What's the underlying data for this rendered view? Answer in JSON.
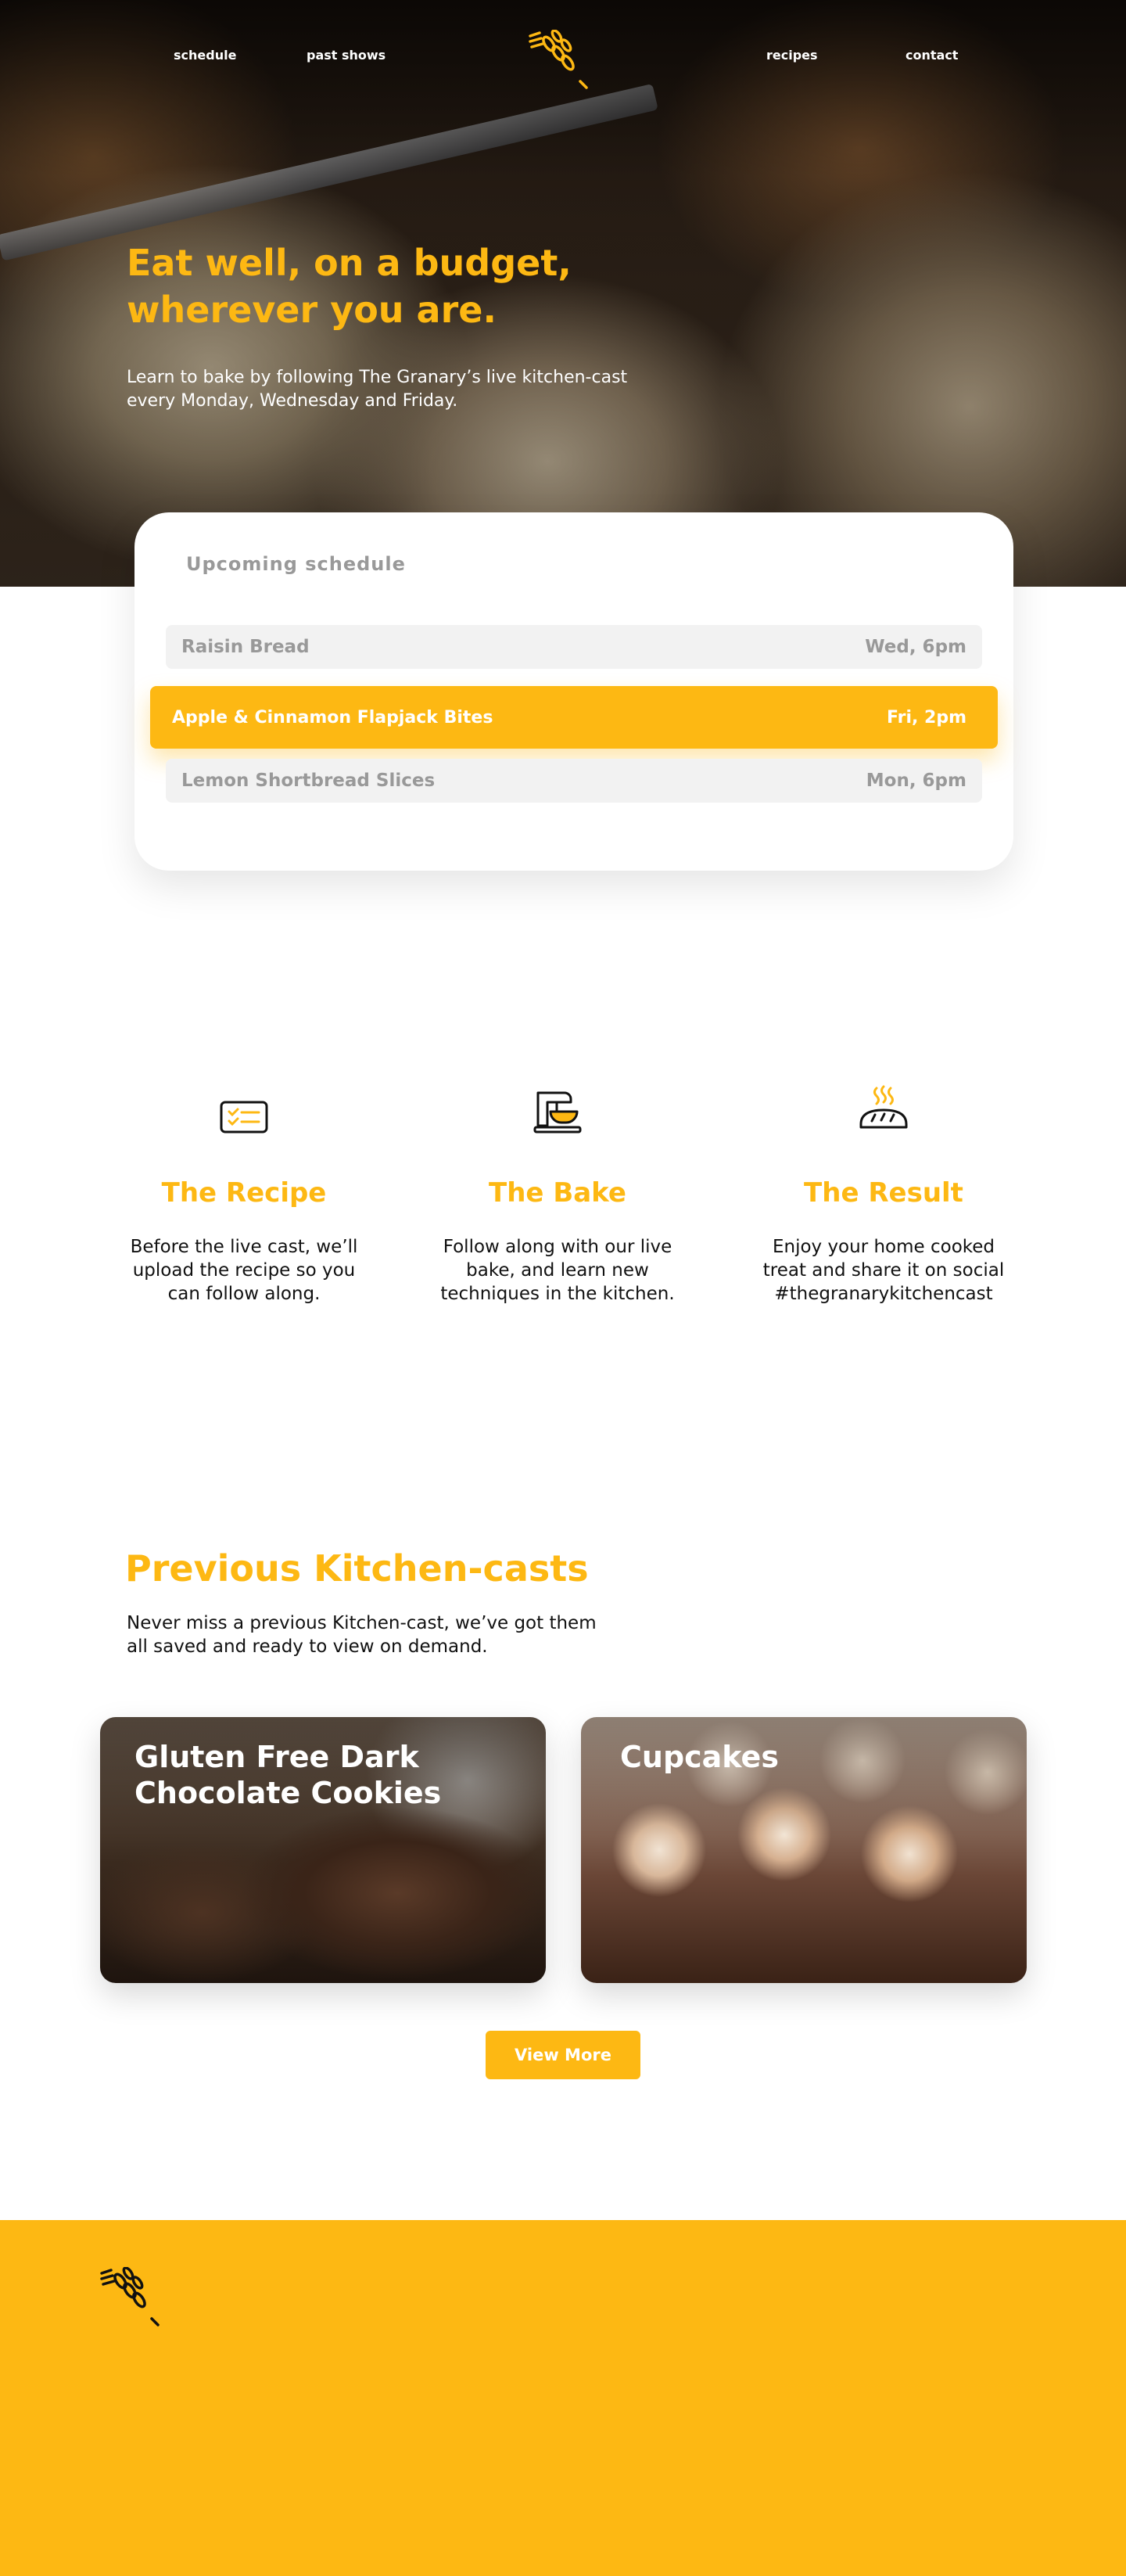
{
  "nav": {
    "schedule": "schedule",
    "past_shows": "past shows",
    "recipes": "recipes",
    "contact": "contact"
  },
  "hero": {
    "title": "Eat well, on a budget, wherever you are.",
    "subtitle": "Learn to bake by following The Granary’s live kitchen-cast every Monday, Wednesday and Friday."
  },
  "schedule": {
    "heading": "Upcoming schedule",
    "items": [
      {
        "name": "Raisin Bread",
        "time": "Wed, 6pm",
        "active": false
      },
      {
        "name": "Apple & Cinnamon Flapjack Bites",
        "time": "Fri, 2pm",
        "active": true
      },
      {
        "name": "Lemon Shortbread Slices",
        "time": "Mon, 6pm",
        "active": false
      }
    ]
  },
  "steps": [
    {
      "icon": "recipe-card-icon",
      "title": "The Recipe",
      "text": "Before the live cast, we’ll upload the recipe so you can follow along."
    },
    {
      "icon": "stand-mixer-icon",
      "title": "The Bake",
      "text": "Follow along with our live bake, and learn new techniques in the kitchen."
    },
    {
      "icon": "bread-loaf-icon",
      "title": "The Result",
      "text": "Enjoy your home cooked treat and share it on social #thegranarykitchencast"
    }
  ],
  "previous": {
    "title": "Previous Kitchen-casts",
    "subtitle": "Never miss a previous Kitchen-cast, we’ve got them all saved and ready to view on demand.",
    "casts": [
      {
        "title": "Gluten Free Dark Chocolate Cookies"
      },
      {
        "title": "Cupcakes"
      }
    ],
    "view_more": "View More"
  },
  "colors": {
    "accent": "#FDB813",
    "row_bg": "#F2F2F2",
    "muted_text": "#999999",
    "footer": "#FDB813"
  }
}
